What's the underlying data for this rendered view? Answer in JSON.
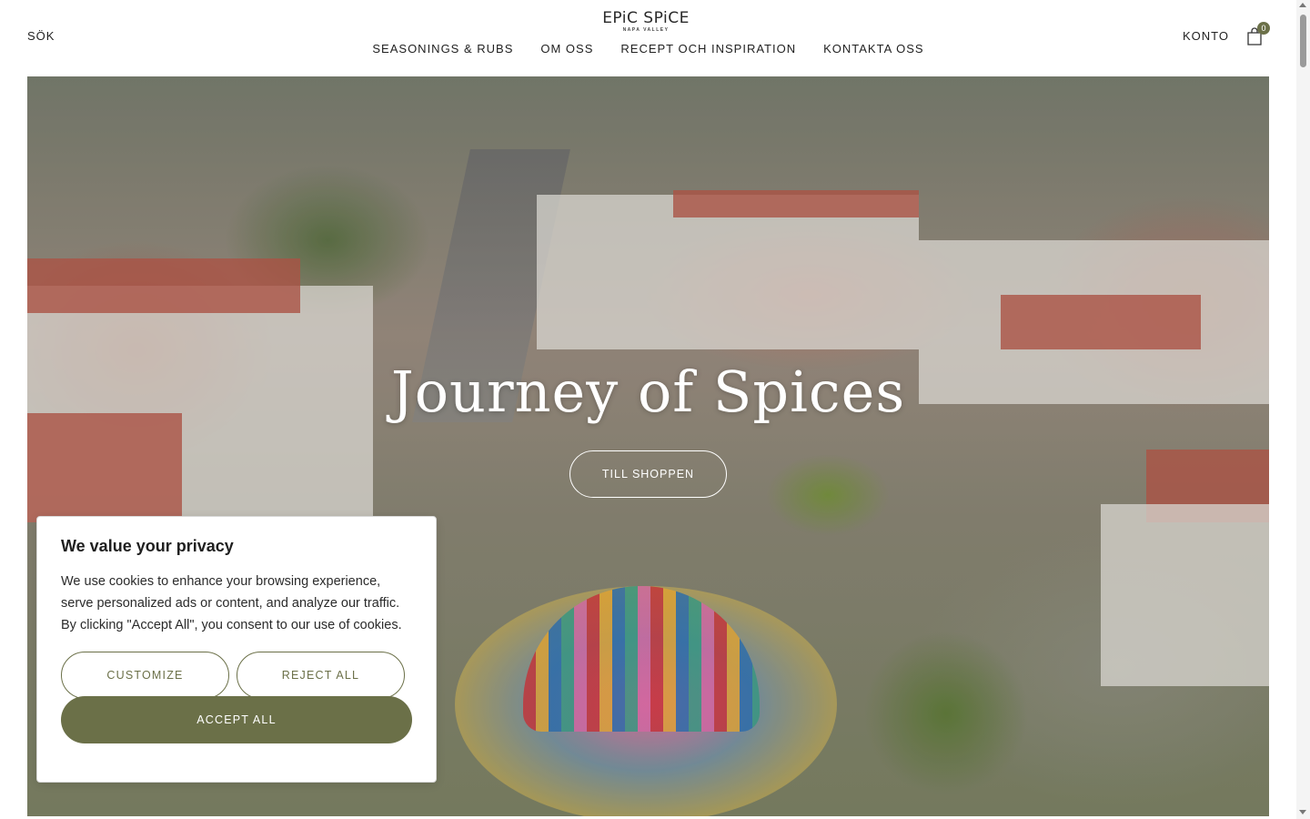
{
  "header": {
    "search_label": "SÖK",
    "logo_main": "EPiC SPiCE",
    "logo_sub": "NAPA VALLEY",
    "nav": [
      "SEASONINGS & RUBS",
      "OM OSS",
      "RECEPT OCH INSPIRATION",
      "KONTAKTA OSS"
    ],
    "account_label": "KONTO",
    "cart_count": "0"
  },
  "hero": {
    "title": "Journey of Spices",
    "cta_label": "TILL SHOPPEN"
  },
  "cookie": {
    "title": "We value your privacy",
    "body": "We use cookies to enhance your browsing experience, serve personalized ads or content, and analyze our traffic. By clicking \"Accept All\", you consent to our use of cookies.",
    "customize_label": "CUSTOMIZE",
    "reject_label": "REJECT ALL",
    "accept_label": "ACCEPT ALL"
  },
  "colors": {
    "accent": "#6b7048",
    "background": "#ffffff",
    "text": "#222222"
  },
  "icons": {
    "cart": "shopping-bag-icon",
    "logo": "epic-spice-logo"
  }
}
